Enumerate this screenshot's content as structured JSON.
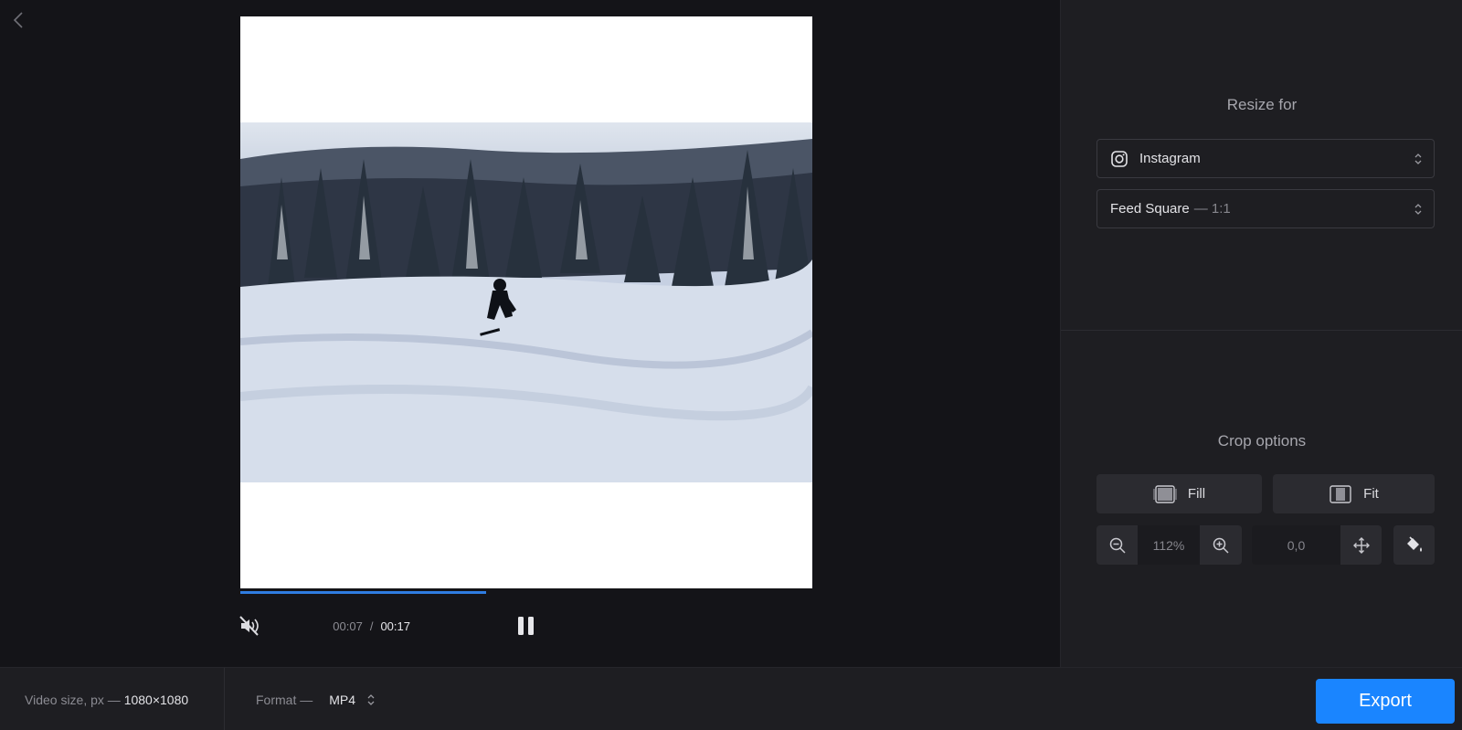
{
  "resize": {
    "title": "Resize for",
    "platform": "Instagram",
    "preset": "Feed Square",
    "preset_ratio": "— 1:1"
  },
  "crop": {
    "title": "Crop options",
    "fill_label": "Fill",
    "fit_label": "Fit",
    "zoom_value": "112%",
    "position_value": "0,0"
  },
  "player": {
    "current_time": "00:07",
    "separator": "/",
    "total_time": "00:17",
    "progress": 0.43
  },
  "bottom": {
    "size_label": "Video size, px —",
    "size_value": "1080×1080",
    "format_label": "Format —",
    "format_value": "MP4",
    "export_label": "Export"
  },
  "colors": {
    "accent": "#1a85ff",
    "progress": "#2f7de1",
    "panel_bg": "#1e1e22",
    "app_bg": "#141418"
  },
  "icons": {
    "back": "chevron-left-icon",
    "mute": "speaker-muted-icon",
    "pause": "pause-icon",
    "instagram": "instagram-icon",
    "select_arrows": "up-down-arrows-icon",
    "fill": "fill-crop-icon",
    "fit": "fit-crop-icon",
    "zoom_out": "zoom-out-icon",
    "zoom_in": "zoom-in-icon",
    "move": "move-arrows-icon",
    "paint_bucket": "paint-bucket-icon"
  }
}
